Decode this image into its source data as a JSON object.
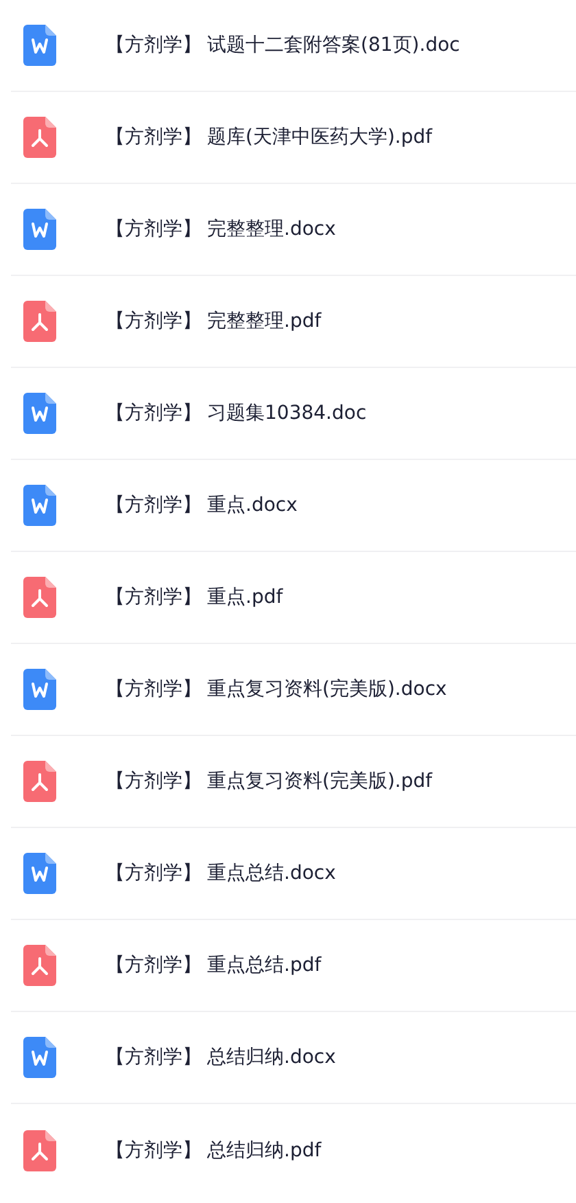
{
  "files": [
    {
      "kind": "word",
      "tag": "【方剂学】",
      "name": "试题十二套附答案(81页).doc"
    },
    {
      "kind": "pdf",
      "tag": "【方剂学】",
      "name": "题库(天津中医药大学).pdf"
    },
    {
      "kind": "word",
      "tag": "【方剂学】",
      "name": "完整整理.docx"
    },
    {
      "kind": "pdf",
      "tag": "【方剂学】",
      "name": "完整整理.pdf"
    },
    {
      "kind": "word",
      "tag": "【方剂学】",
      "name": "习题集10384.doc"
    },
    {
      "kind": "word",
      "tag": "【方剂学】",
      "name": "重点.docx"
    },
    {
      "kind": "pdf",
      "tag": "【方剂学】",
      "name": "重点.pdf"
    },
    {
      "kind": "word",
      "tag": "【方剂学】",
      "name": "重点复习资料(完美版).docx"
    },
    {
      "kind": "pdf",
      "tag": "【方剂学】",
      "name": "重点复习资料(完美版).pdf"
    },
    {
      "kind": "word",
      "tag": "【方剂学】",
      "name": "重点总结.docx"
    },
    {
      "kind": "pdf",
      "tag": "【方剂学】",
      "name": "重点总结.pdf"
    },
    {
      "kind": "word",
      "tag": "【方剂学】",
      "name": "总结归纳.docx"
    },
    {
      "kind": "pdf",
      "tag": "【方剂学】",
      "name": "总结归纳.pdf"
    }
  ]
}
